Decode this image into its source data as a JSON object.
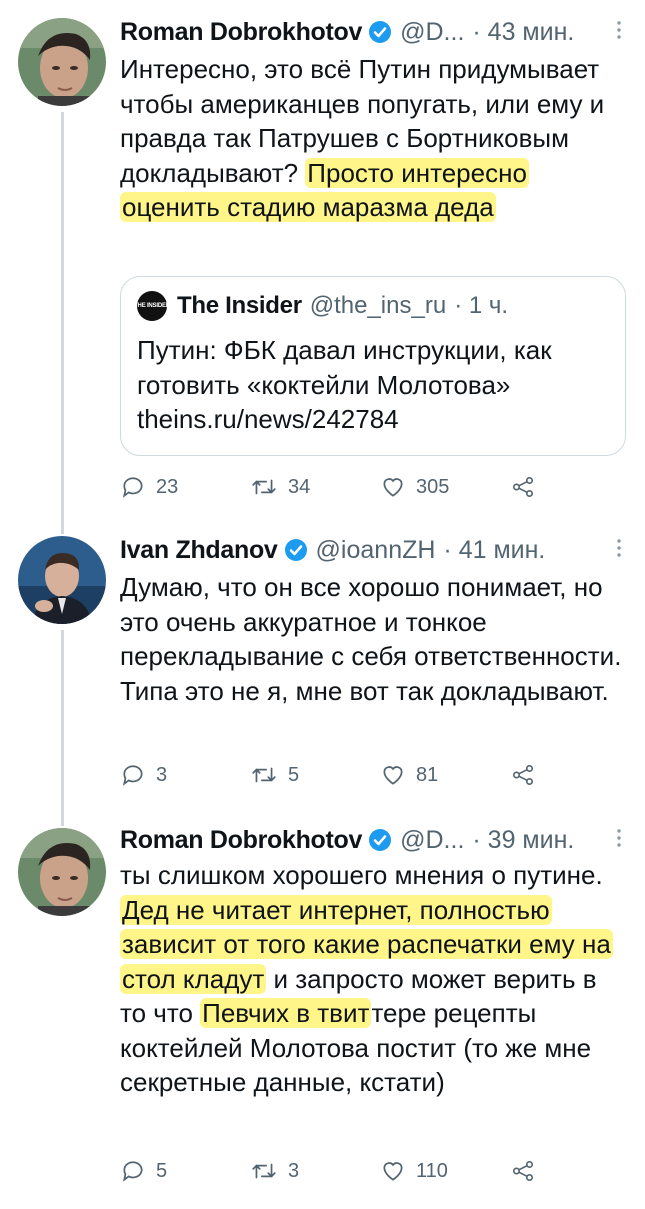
{
  "tweets": [
    {
      "author": "Roman Dobrokhotov",
      "handle": "@D...",
      "time": "· 43 мин.",
      "text_plain": "Интересно, это всё Путин придумывает чтобы американцев попугать, или ему и правда так Патрушев с Бортниковым докладывают? ",
      "text_highlight": "Просто интересно оценить стадию маразма деда",
      "quote": {
        "author": "The Insider",
        "avatar_text": "THE INSIDER",
        "handle": "@the_ins_ru",
        "time": "· 1 ч.",
        "text": "Путин: ФБК давал инструкции, как готовить «коктейли Молотова»",
        "link": "theins.ru/news/242784"
      },
      "replies": "23",
      "retweets": "34",
      "likes": "305"
    },
    {
      "author": "Ivan Zhdanov",
      "handle": "@ioannZH",
      "time": "· 41 мин.",
      "text_plain": "Думаю, что он все хорошо понимает, но это очень аккуратное и тонкое перекладывание с себя ответственности. Типа это не я, мне вот так докладывают.",
      "replies": "3",
      "retweets": "5",
      "likes": "81"
    },
    {
      "author": "Roman Dobrokhotov",
      "handle": "@D...",
      "time": "· 39 мин.",
      "text_a": "ты слишком хорошего мнения о путине. ",
      "text_hl1": "Дед не читает интернет, полностью зависит от того какие распечатки ему на стол кладут",
      "text_b": " и запросто может верить в то что ",
      "text_hl2": "Певчих в твит",
      "text_c": "тере рецепты коктейлей Молотова постит (то же мне секретные данные, кстати)",
      "replies": "5",
      "retweets": "3",
      "likes": "110"
    }
  ],
  "colors": {
    "verified": "#1d9bf0",
    "secondary_text": "#536471",
    "highlight": "#ffec28",
    "thread_line": "#cfd9de"
  },
  "icons": [
    "verified-badge-icon",
    "more-icon",
    "reply-icon",
    "retweet-icon",
    "like-icon",
    "share-icon"
  ]
}
